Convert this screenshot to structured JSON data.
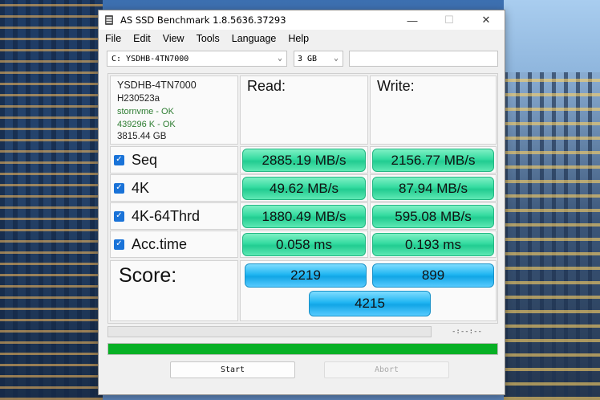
{
  "window": {
    "title": "AS SSD Benchmark 1.8.5636.37293",
    "controls": {
      "minimize": "—",
      "maximize": "☐",
      "close": "✕"
    }
  },
  "menu": [
    "File",
    "Edit",
    "View",
    "Tools",
    "Language",
    "Help"
  ],
  "toolbar": {
    "drive": "C: YSDHB-4TN7000",
    "size": "3 GB",
    "extra": ""
  },
  "drive_info": {
    "model": "YSDHB-4TN7000",
    "firmware": "H230523a",
    "driver": "stornvme - OK",
    "alignment": "439296 K - OK",
    "capacity": "3815.44 GB"
  },
  "headers": {
    "read": "Read:",
    "write": "Write:"
  },
  "tests": [
    {
      "label": "Seq",
      "checked": true,
      "read": "2885.19 MB/s",
      "write": "2156.77 MB/s"
    },
    {
      "label": "4K",
      "checked": true,
      "read": "49.62 MB/s",
      "write": "87.94 MB/s"
    },
    {
      "label": "4K-64Thrd",
      "checked": true,
      "read": "1880.49 MB/s",
      "write": "595.08 MB/s"
    },
    {
      "label": "Acc.time",
      "checked": true,
      "read": "0.058 ms",
      "write": "0.193 ms"
    }
  ],
  "score": {
    "label": "Score:",
    "read": "2219",
    "write": "899",
    "total": "4215"
  },
  "progress": {
    "time": "-:--:--",
    "overall_fraction": 1.0
  },
  "buttons": {
    "start": "Start",
    "abort": "Abort"
  },
  "colors": {
    "result_green": "#22cc91",
    "score_blue": "#12a6e6",
    "progress_green": "#06b025"
  }
}
